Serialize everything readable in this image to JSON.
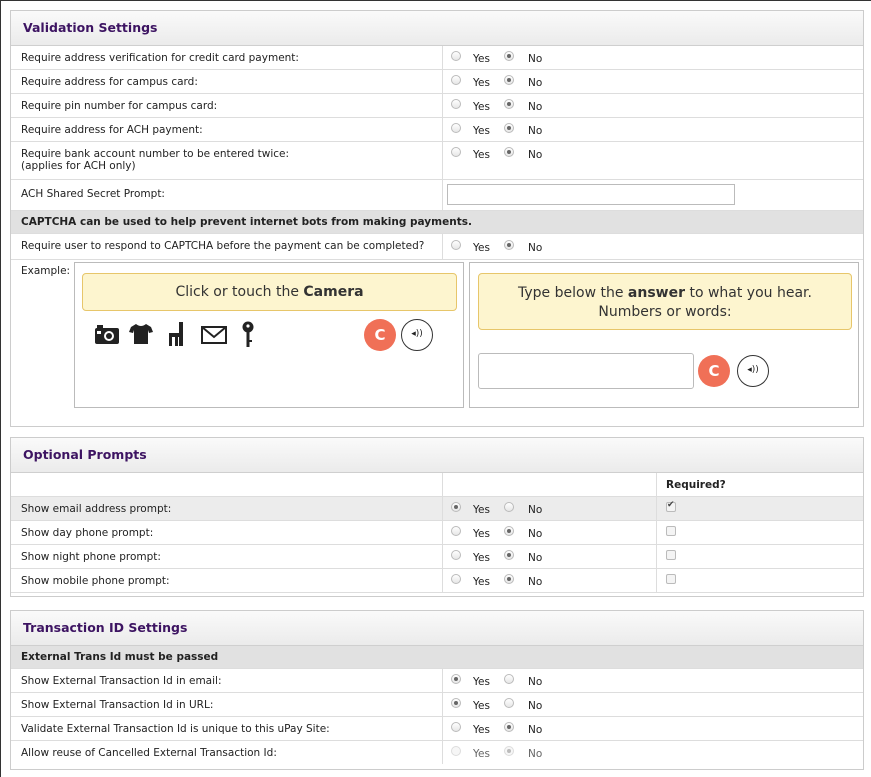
{
  "validation": {
    "title": "Validation Settings",
    "rows": [
      {
        "label": "Require address verification for credit card payment:",
        "value": "No"
      },
      {
        "label": "Require address for campus card:",
        "value": "No"
      },
      {
        "label": "Require pin number for campus card:",
        "value": "No"
      },
      {
        "label": "Require address for ACH payment:",
        "value": "No"
      },
      {
        "label": "Require bank account number to be entered twice:",
        "label2": "(applies for ACH only)",
        "value": "No"
      }
    ],
    "ach_prompt_label": "ACH Shared Secret Prompt:",
    "ach_prompt_value": "",
    "captcha_note": "CAPTCHA can be used to help prevent internet bots from making payments.",
    "captcha_require_label": "Require user to respond to CAPTCHA before the payment can be completed?",
    "captcha_require_value": "No",
    "example_label": "Example:",
    "captcha_visual": {
      "instruction_prefix": "Click or touch the ",
      "instruction_bold": "Camera",
      "icons": [
        "camera-icon",
        "tshirt-icon",
        "chair-icon",
        "envelope-icon",
        "key-icon"
      ],
      "refresh_glyph": "C",
      "audio_glyph": "◂))"
    },
    "captcha_audio": {
      "line1_prefix": "Type below the ",
      "line1_bold": "answer",
      "line1_suffix": " to what you hear.",
      "line2": "Numbers or words:",
      "answer_value": ""
    }
  },
  "radio_labels": {
    "yes": "Yes",
    "no": "No"
  },
  "optional": {
    "title": "Optional Prompts",
    "required_header": "Required?",
    "rows": [
      {
        "label": "Show email address prompt:",
        "value": "Yes",
        "required": true
      },
      {
        "label": "Show day phone prompt:",
        "value": "No",
        "required": false
      },
      {
        "label": "Show night phone prompt:",
        "value": "No",
        "required": false
      },
      {
        "label": "Show mobile phone prompt:",
        "value": "No",
        "required": false
      }
    ]
  },
  "transaction": {
    "title": "Transaction ID Settings",
    "subhead": "External Trans Id must be passed",
    "rows": [
      {
        "label": "Show External Transaction Id in email:",
        "value": "Yes"
      },
      {
        "label": "Show External Transaction Id in URL:",
        "value": "Yes"
      },
      {
        "label": "Validate External Transaction Id is unique to this uPay Site:",
        "value": "No"
      },
      {
        "label": "Allow reuse of Cancelled External Transaction Id:",
        "value": "No",
        "disabled": true
      }
    ]
  }
}
